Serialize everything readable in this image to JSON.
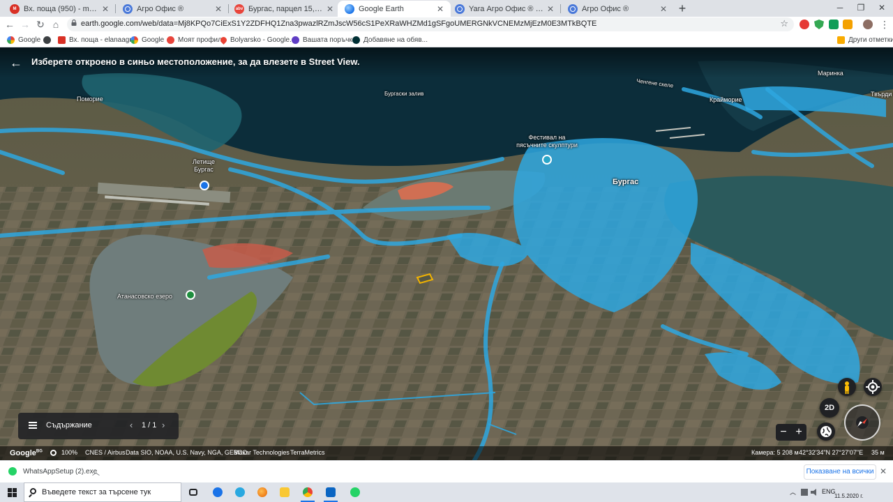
{
  "tabs": [
    {
      "title": "Вх. поща (950) - mollov67@gmail.com",
      "icon": "gmail-icon"
    },
    {
      "title": "Агро Офис ®",
      "icon": "globe-icon"
    },
    {
      "title": "Бургас, парцел 15,000 дка. -Чартъ",
      "icon": "abv-icon"
    },
    {
      "title": "Google Earth",
      "icon": "google-earth-icon"
    },
    {
      "title": "Yara Агро Офис ® Карти - Agro",
      "icon": "globe-icon"
    },
    {
      "title": "Агро Офис ®",
      "icon": "globe-icon"
    }
  ],
  "active_tab": 3,
  "window_controls": {
    "minimize": "─",
    "maximize": "❐",
    "close": "✕"
  },
  "address_bar": {
    "url": "earth.google.com/web/data=Mj8KPQo7CiExS1Y2ZDFHQ1Zna3pwazlRZmJscW56cS1PeXRaWHZMd1gSFgoUMERGNkVCNEMzMjEzM0E3MTkBQTE"
  },
  "bookmarks": [
    {
      "label": "Google",
      "icon": "google-icon"
    },
    {
      "label": "",
      "icon": "globe-icon"
    },
    {
      "label": "Вх. поща - elanaagr...",
      "icon": "gmail-icon"
    },
    {
      "label": "Google",
      "icon": "google-icon"
    },
    {
      "label": "Моят профил",
      "icon": "abv-icon"
    },
    {
      "label": "Bolyarsko - Google...",
      "icon": "maps-pin-icon"
    },
    {
      "label": "Вашата поръчка",
      "icon": "shop-icon"
    },
    {
      "label": "Добавяне на обяв...",
      "icon": "olx-icon"
    }
  ],
  "other_bookmarks": "Други отметки",
  "street_view_banner": "Изберете откроено в синьо местоположение, за да влезете в Street View.",
  "map_labels": {
    "pomorie": "Поморие",
    "burgas_bay": "Бургаски залив",
    "chengene_skele": "Ченгене скеле",
    "marinka": "Маринка",
    "kraimorie": "Крайморие",
    "tvarditsa": "Твърди",
    "festival_line1": "Фестивал на",
    "festival_line2": "пясъчните скулптури",
    "airport_line1": "Летище",
    "airport_line2": "Бургас",
    "burgas": "Бургас",
    "atanasovsko": "Атанасовско езеро"
  },
  "toc": {
    "title": "Съдържание",
    "page": "1 / 1",
    "prev": "‹",
    "next": "›"
  },
  "controls": {
    "mode_2d": "2D",
    "zoom_out": "−",
    "zoom_in": "+"
  },
  "attribution": {
    "logo": "Google",
    "logo_suffix": "BG",
    "opacity": "100%",
    "credits": [
      "CNES / Airbus",
      "Data SIO, NOAA, U.S. Navy, NGA, GEBCO",
      "Maxar Technologies",
      "TerraMetrics"
    ],
    "camera": "Камера: 5 208 м",
    "coords": "42°32'34\"N 27°27'07\"E",
    "altitude": "35 м"
  },
  "download": {
    "filename": "WhatsAppSetup (2).exe",
    "show_all": "Показване на всички",
    "close": "✕"
  },
  "taskbar": {
    "search_placeholder": "Въведете текст за търсене тук",
    "lang": "ENG",
    "date": "11.5.2020 г."
  },
  "colors": {
    "street_view_blue": "#2ea7e0",
    "sea": "#0c2d3a",
    "lagoon": "#2e6c78"
  }
}
